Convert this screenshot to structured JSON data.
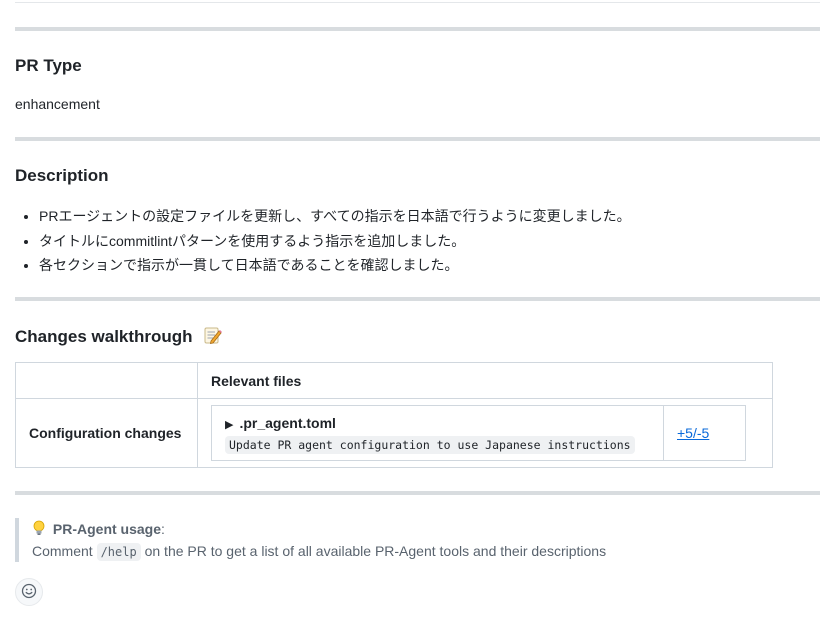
{
  "sections": {
    "pr_type": {
      "heading": "PR Type",
      "value": "enhancement"
    },
    "description": {
      "heading": "Description",
      "items": [
        "PRエージェントの設定ファイルを更新し、すべての指示を日本語で行うように変更しました。",
        "タイトルにcommitlintパターンを使用するよう指示を追加しました。",
        "各セクションで指示が一貫して日本語であることを確認しました。"
      ]
    },
    "walkthrough": {
      "heading": "Changes walkthrough",
      "heading_icon": "memo-icon",
      "column_header": "Relevant files",
      "rows": [
        {
          "category": "Configuration changes",
          "file_name": ".pr_agent.toml",
          "file_description": "Update PR agent configuration to use Japanese instructions",
          "diff": "+5/-5"
        }
      ]
    },
    "usage": {
      "icon": "lightbulb-icon",
      "title": "PR-Agent usage",
      "title_suffix": ":",
      "line_prefix": "Comment",
      "command": "/help",
      "line_suffix": "on the PR to get a list of all available PR-Agent tools and their descriptions"
    }
  },
  "reaction_icon": "smiley-icon",
  "colors": {
    "link": "#0969da",
    "rule": "#d8dcdf",
    "text": "#1f2328",
    "muted": "#59636e"
  }
}
